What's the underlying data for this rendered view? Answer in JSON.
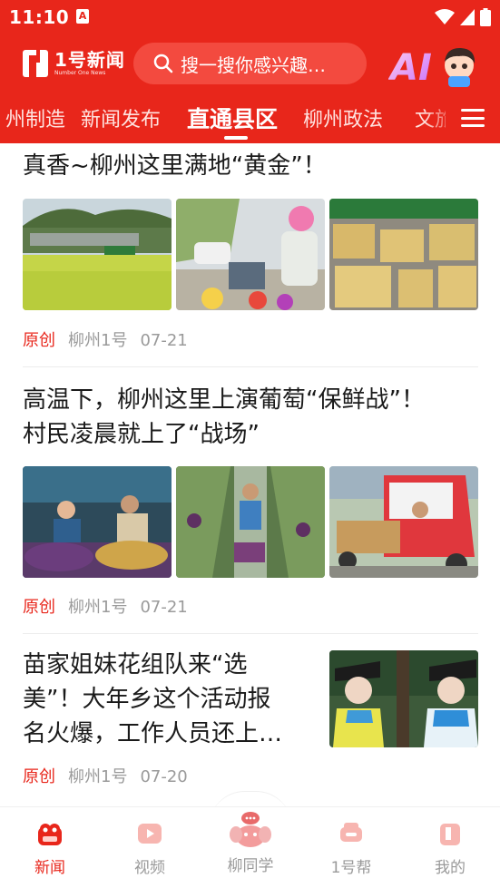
{
  "status_bar": {
    "time": "11:10",
    "notification_icon": "A"
  },
  "header": {
    "logo_text": "1号新闻",
    "logo_subtext": "Number One News",
    "search_placeholder": "搜一搜你感兴趣…",
    "ai_label": "AI"
  },
  "tabs": [
    {
      "label": "州制造"
    },
    {
      "label": "新闻发布"
    },
    {
      "label": "直通县区",
      "active": true
    },
    {
      "label": "柳州政法"
    },
    {
      "label": "文旅"
    }
  ],
  "articles": [
    {
      "title": "真香~柳州这里满地“黄金”！",
      "tag": "原创",
      "source": "柳州1号",
      "date": "07-21"
    },
    {
      "title_line1": "高温下，柳州这里上演葡萄“保鲜战”！",
      "title_line2": "村民凌晨就上了“战场”",
      "tag": "原创",
      "source": "柳州1号",
      "date": "07-21"
    },
    {
      "title_line1": "苗家姐妹花组队来“选",
      "title_line2": "美”！大年乡这个活动报",
      "title_line3": "名火爆，工作人员还上…",
      "tag": "原创",
      "source": "柳州1号",
      "date": "07-20"
    }
  ],
  "bottom_nav": [
    {
      "label": "新闻",
      "icon": "news-icon",
      "active": true
    },
    {
      "label": "视频",
      "icon": "video-icon"
    },
    {
      "label": "柳同学",
      "icon": "elephant-icon"
    },
    {
      "label": "1号帮",
      "icon": "help-icon"
    },
    {
      "label": "我的",
      "icon": "profile-icon"
    }
  ],
  "colors": {
    "brand": "#e8261b",
    "meta_gray": "#9a9a9a"
  }
}
